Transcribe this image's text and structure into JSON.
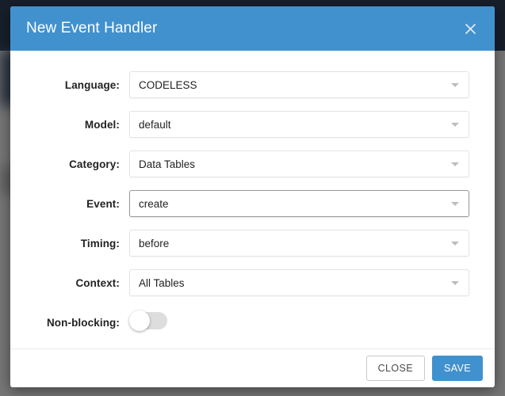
{
  "dialog": {
    "title": "New Event Handler",
    "close_icon": "close-icon"
  },
  "form": {
    "rows": [
      {
        "label": "Language:",
        "value": "CODELESS",
        "type": "select",
        "focused": false
      },
      {
        "label": "Model:",
        "value": "default",
        "type": "select",
        "focused": false
      },
      {
        "label": "Category:",
        "value": "Data Tables",
        "type": "select",
        "focused": false
      },
      {
        "label": "Event:",
        "value": "create",
        "type": "select",
        "focused": true
      },
      {
        "label": "Timing:",
        "value": "before",
        "type": "select",
        "focused": false
      },
      {
        "label": "Context:",
        "value": "All Tables",
        "type": "select",
        "focused": false
      },
      {
        "label": "Non-blocking:",
        "value": "off",
        "type": "toggle",
        "focused": false
      }
    ]
  },
  "footer": {
    "close_label": "CLOSE",
    "save_label": "SAVE"
  },
  "colors": {
    "accent": "#4191ce",
    "header_bg": "#4191ce",
    "backdrop": "#767676",
    "backdrop_topbar": "#171f2b",
    "border": "#e3e3e3",
    "focused_border": "#9a9a9a",
    "toggle_track": "#dddddd",
    "text": "#222222"
  }
}
